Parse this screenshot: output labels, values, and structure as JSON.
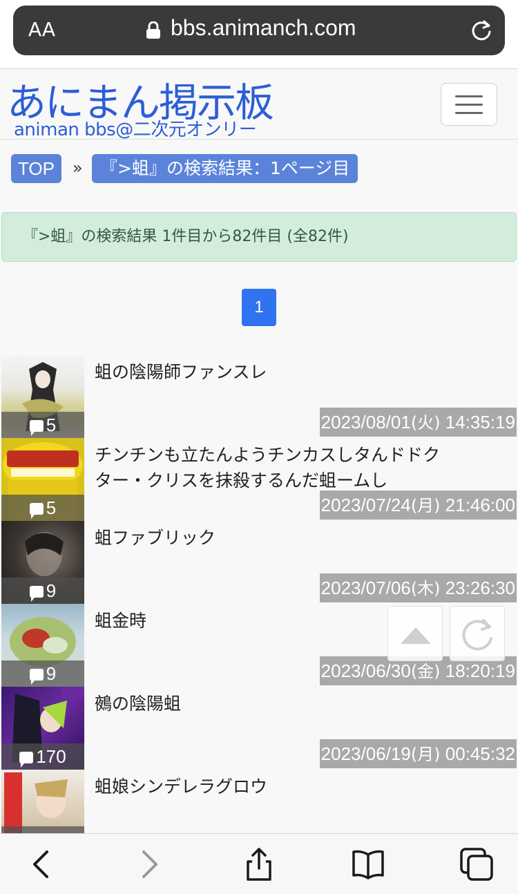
{
  "browser": {
    "text_size_label": "AA",
    "url": "bbs.animanch.com"
  },
  "site": {
    "logo": "あにまん掲示板",
    "logo_sub": "animan bbs@二次元オンリー"
  },
  "breadcrumb": {
    "top": "TOP",
    "separator": "»",
    "current": "『>蛆』の検索結果：1ページ目"
  },
  "alert": "『>蛆』の検索結果 1件目から82件目 (全82件)",
  "pagination": {
    "current": "1"
  },
  "threads": [
    {
      "title": "蛆の陰陽師ファンスレ",
      "count": "5",
      "date": "2023/08/01",
      "weekday": "(火)",
      "time": "14:35:19"
    },
    {
      "title": "チンチンも立たんようチンカスしタんドドクター・クリスを抹殺するんだ蛆ームし",
      "count": "5",
      "date": "2023/07/24",
      "weekday": "(月)",
      "time": "21:46:00"
    },
    {
      "title": "蛆ファブリック",
      "count": "9",
      "date": "2023/07/06",
      "weekday": "(木)",
      "time": "23:26:30"
    },
    {
      "title": "蛆金時",
      "count": "9",
      "date": "2023/06/30",
      "weekday": "(金)",
      "time": "18:20:19"
    },
    {
      "title": "鵺の陰陽蛆",
      "count": "170",
      "date": "2023/06/19",
      "weekday": "(月)",
      "time": "00:45:32"
    },
    {
      "title": "蛆娘シンデレラグロウ",
      "count": "",
      "date": "",
      "weekday": "",
      "time": ""
    }
  ],
  "colors": {
    "accent": "#2c5ed6",
    "badge": "#5b83d9",
    "pager": "#2f73f0",
    "alert_bg": "#d4ecdc",
    "date_bg": "#a9a9a9"
  }
}
